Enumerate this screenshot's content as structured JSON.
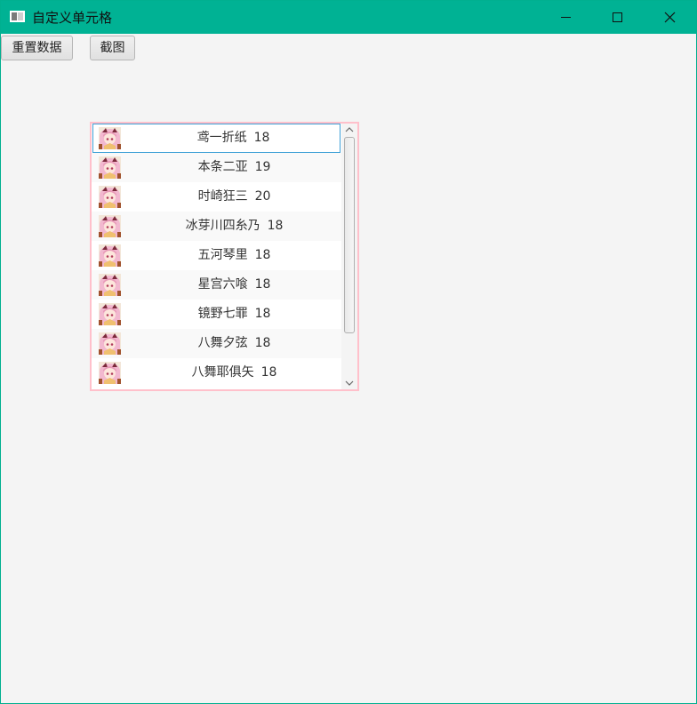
{
  "window": {
    "title": "自定义单元格"
  },
  "toolbar": {
    "reset_label": "重置数据",
    "screenshot_label": "截图"
  },
  "list": {
    "border_color": "#ffc0cb",
    "selection_color": "#3c9fd6",
    "items": [
      {
        "name": "鸢一折纸",
        "age": "18",
        "icon": "anime-avatar-icon"
      },
      {
        "name": "本条二亚",
        "age": "19",
        "icon": "anime-avatar-icon"
      },
      {
        "name": "时崎狂三",
        "age": "20",
        "icon": "anime-avatar-icon"
      },
      {
        "name": "冰芽川四糸乃",
        "age": "18",
        "icon": "anime-avatar-icon"
      },
      {
        "name": "五河琴里",
        "age": "18",
        "icon": "anime-avatar-icon"
      },
      {
        "name": "星宫六喰",
        "age": "18",
        "icon": "anime-avatar-icon"
      },
      {
        "name": "镜野七罪",
        "age": "18",
        "icon": "anime-avatar-icon"
      },
      {
        "name": "八舞夕弦",
        "age": "18",
        "icon": "anime-avatar-icon"
      },
      {
        "name": "八舞耶俱矢",
        "age": "18",
        "icon": "anime-avatar-icon"
      }
    ]
  },
  "colors": {
    "titlebar": "#00b294",
    "window_bg": "#f4f4f4"
  }
}
